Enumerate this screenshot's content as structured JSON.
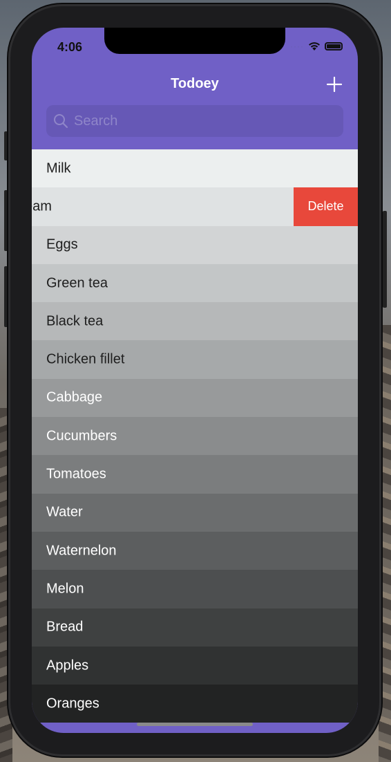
{
  "status_bar": {
    "time": "4:06"
  },
  "nav": {
    "title": "Todoey",
    "add_icon": "plus-icon"
  },
  "search": {
    "placeholder": "Search",
    "value": ""
  },
  "items": [
    {
      "label": "Milk",
      "bg": "#ecefef",
      "color": "#1e1e1e"
    },
    {
      "label": "eam",
      "bg": "#dfe2e3",
      "color": "#1e1e1e",
      "swiped": true
    },
    {
      "label": "Eggs",
      "bg": "#d2d4d5",
      "color": "#1e1e1e"
    },
    {
      "label": "Green tea",
      "bg": "#c3c6c7",
      "color": "#1e1e1e"
    },
    {
      "label": "Black tea",
      "bg": "#b6b8b9",
      "color": "#1e1e1e"
    },
    {
      "label": "Chicken fillet",
      "bg": "#a6a9aa",
      "color": "#1e1e1e"
    },
    {
      "label": "Cabbage",
      "bg": "#989a9b",
      "color": "#ffffff"
    },
    {
      "label": "Cucumbers",
      "bg": "#8a8c8d",
      "color": "#ffffff"
    },
    {
      "label": "Tomatoes",
      "bg": "#7b7d7e",
      "color": "#ffffff"
    },
    {
      "label": "Water",
      "bg": "#6b6d6e",
      "color": "#ffffff"
    },
    {
      "label": "Waternelon",
      "bg": "#5c5e5f",
      "color": "#ffffff"
    },
    {
      "label": "Melon",
      "bg": "#4d4f50",
      "color": "#ffffff"
    },
    {
      "label": "Bread",
      "bg": "#3f4141",
      "color": "#ffffff"
    },
    {
      "label": "Apples",
      "bg": "#303232",
      "color": "#ffffff"
    },
    {
      "label": "Oranges",
      "bg": "#222323",
      "color": "#ffffff"
    }
  ],
  "delete_action": {
    "label": "Delete",
    "color": "#e8483b"
  },
  "colors": {
    "nav_bg": "#7060c6"
  }
}
